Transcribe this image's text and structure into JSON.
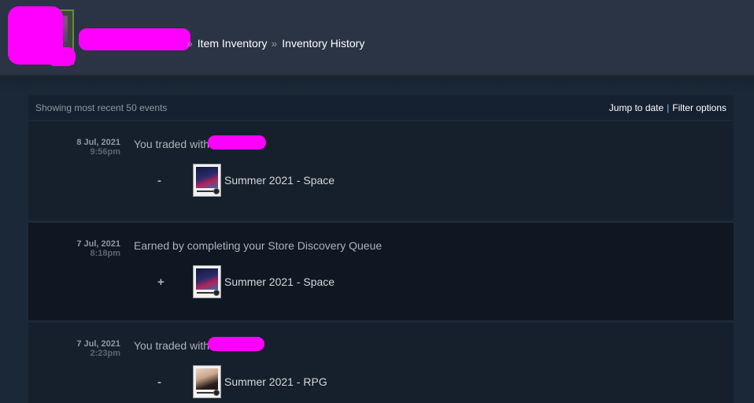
{
  "breadcrumb": {
    "item_inventory": "Item Inventory",
    "inventory_history": "Inventory History",
    "separator": "»"
  },
  "toolbar": {
    "summary": "Showing most recent 50 events",
    "jump_to_date": "Jump to date",
    "pipe": "|",
    "filter_options": "Filter options"
  },
  "events": [
    {
      "date": "8 Jul, 2021",
      "time": "9:56pm",
      "description": "You traded with",
      "sign": "-",
      "item": {
        "name": "Summer 2021 - Space",
        "icon": "trading-card-space-icon"
      }
    },
    {
      "date": "7 Jul, 2021",
      "time": "8:18pm",
      "description": "Earned by completing your Store Discovery Queue",
      "sign": "+",
      "item": {
        "name": "Summer 2021 - Space",
        "icon": "trading-card-space-icon"
      }
    },
    {
      "date": "7 Jul, 2021",
      "time": "2:23pm",
      "description": "You traded with",
      "sign": "-",
      "item": {
        "name": "Summer 2021 - RPG",
        "icon": "trading-card-rpg-icon"
      }
    }
  ],
  "colors": {
    "page_background": "#1b2838",
    "header_background": "#2a3444",
    "redaction": "#ff00ff",
    "link_accent": "#67c1f5"
  }
}
